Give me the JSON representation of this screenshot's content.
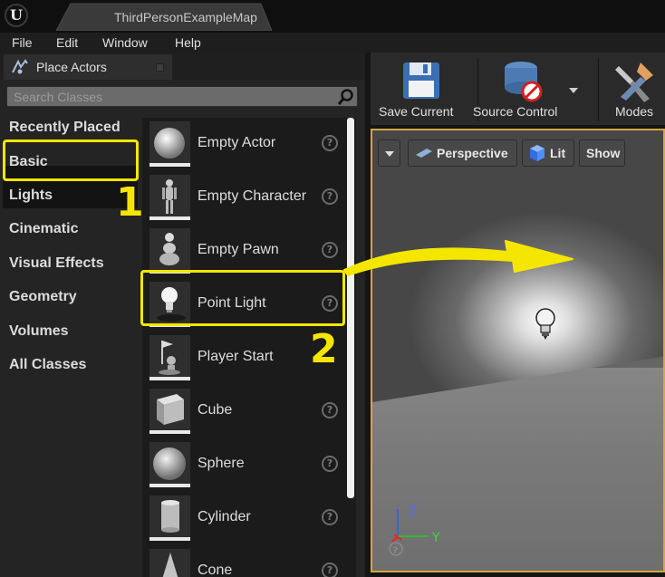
{
  "window": {
    "document_tab": "ThirdPersonExampleMap"
  },
  "menu": [
    "File",
    "Edit",
    "Window",
    "Help"
  ],
  "panel": {
    "title": "Place Actors",
    "search_placeholder": "Search Classes",
    "categories": [
      "Recently Placed",
      "Basic",
      "Lights",
      "Cinematic",
      "Visual Effects",
      "Geometry",
      "Volumes",
      "All Classes"
    ],
    "selected_category": "Basic",
    "items": [
      "Empty Actor",
      "Empty Character",
      "Empty Pawn",
      "Point Light",
      "Player Start",
      "Cube",
      "Sphere",
      "Cylinder",
      "Cone"
    ],
    "help_glyph": "?"
  },
  "toolbar": {
    "save": "Save Current",
    "source_control": "Source Control",
    "modes": "Modes"
  },
  "viewport": {
    "view_mode": "Perspective",
    "lighting": "Lit",
    "show": "Show",
    "axes": {
      "z": "Z",
      "y": "Y"
    }
  },
  "annotations": {
    "step1": "1",
    "step2": "2"
  },
  "colors": {
    "highlight": "#f5e600",
    "viewport_border": "#d4a640"
  }
}
